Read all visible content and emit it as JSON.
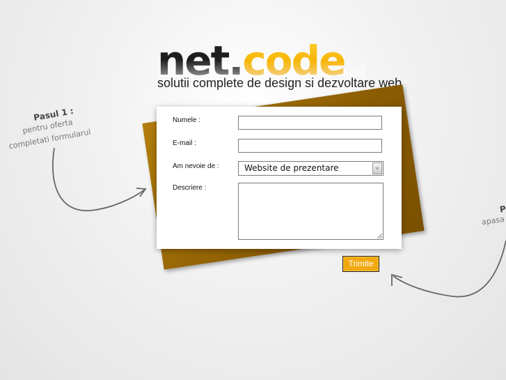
{
  "logo": {
    "part1": "net",
    "dot": ".",
    "part2": "code",
    "tagline": "solutii complete de design si dezvoltare web"
  },
  "form": {
    "name_label": "Numele :",
    "email_label": "E-mail :",
    "need_label": "Am nevoie de :",
    "need_selected": "Website de prezentare",
    "description_label": "Descriere :",
    "name_value": "",
    "email_value": "",
    "description_value": "",
    "submit_label": "Trimite"
  },
  "notes": {
    "step1_title": "Pasul 1 :",
    "step1_line1": "pentru oferta",
    "step1_line2": "completati formularul",
    "step2_title": "P",
    "step2_line1": "apasa"
  },
  "colors": {
    "accent": "#f2a90e",
    "brand_dark": "#1e1e1e",
    "brand_orange": "#f4b000",
    "card": "#8a5c02"
  },
  "icons": {
    "select_arrow": "chevron-down-icon",
    "resize_grip": "resize-grip-icon"
  }
}
